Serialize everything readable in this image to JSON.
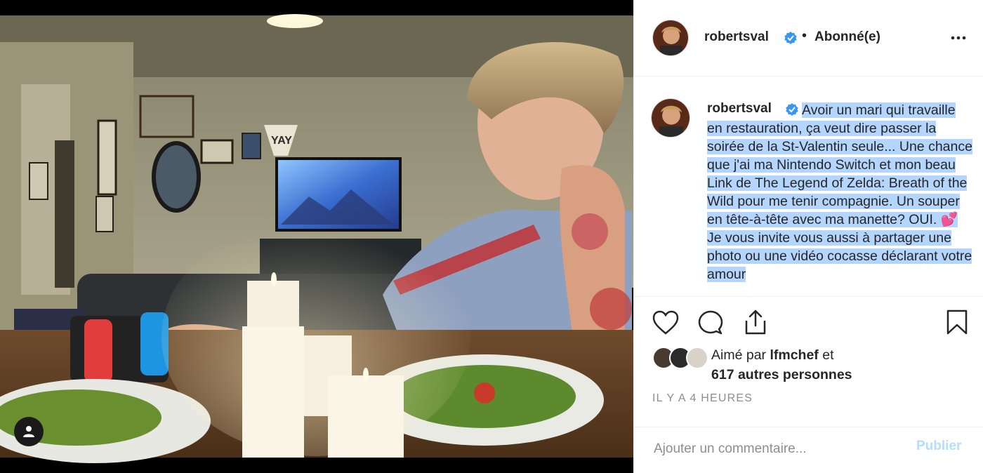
{
  "post": {
    "username": "robertsval",
    "separator": "•",
    "follow_status": "Abonné(e)",
    "caption_plain_start": "",
    "caption_text": "Avoir un mari qui travaille en restauration, ça veut dire passer la soirée de la St-Valentin seule... Une chance que j'ai ma Nintendo Switch et mon beau Link de The Legend of Zelda: Breath of the Wild pour me tenir compagnie. Un souper en tête-à-tête avec ma manette? OUI. 💕 Je vous invite vous aussi à partager une photo ou une vidéo cocasse déclarant votre amour",
    "likes_prefix": "Aimé par",
    "liked_by_user": "lfmchef",
    "likes_conjunction": "et",
    "likes_others": "617 autres personnes",
    "timestamp": "IL Y A 4 HEURES",
    "comment_placeholder": "Ajouter un commentaire...",
    "publish_label": "Publier",
    "photo_sign_text": "YAY"
  },
  "icons": {
    "more": "more-options-icon",
    "verified": "verified-badge-icon",
    "like": "heart-icon",
    "comment": "comment-icon",
    "share": "share-icon",
    "save": "bookmark-icon",
    "tag": "user-tag-icon"
  },
  "colors": {
    "verified_blue": "#3897f0",
    "selection": "#b4d5fe",
    "publish_disabled": "#b2dffc",
    "muted": "#8e8e8e"
  }
}
